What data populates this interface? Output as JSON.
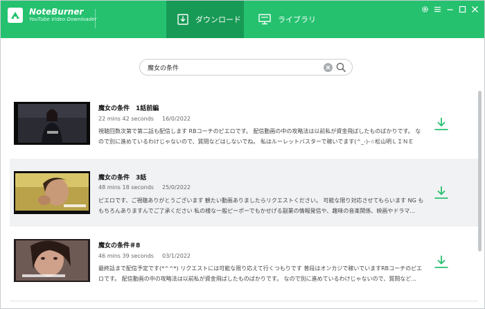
{
  "app": {
    "name": "NoteBurner",
    "subtitle": "YouTube Video Downloader",
    "accent_color": "#25c16f",
    "active_tab_color": "#179a55"
  },
  "tabs": [
    {
      "label": "ダウンロード",
      "icon": "download-icon",
      "active": true
    },
    {
      "label": "ライブラリ",
      "icon": "monitor-icon",
      "active": false
    }
  ],
  "window_controls": [
    "gear-icon",
    "menu-icon",
    "minimize-icon",
    "maximize-icon",
    "close-icon"
  ],
  "search": {
    "value": "魔女の条件",
    "placeholder": ""
  },
  "results": [
    {
      "title": "魔女の条件　1話前編",
      "duration": "22 mins 42 seconds",
      "date": "16/0/2022",
      "description": "視聴回数次第で第二話も配信します RBコーチのピエロです。 配信動画の中の攻略法は以前私が資金飛ばしたものばかりです。 なので別に進めているわけじゃないので、質問などはしないでね。 私はルーレットバスターで稼いでます(^_-)-☆松山明ＬＩＮＥコ..."
    },
    {
      "title": "魔女の条件　3話",
      "duration": "48 mins 18 seconds",
      "date": "25/0/2022",
      "description": "ピエロです、ご視聴ありがとうございます 観たい動画ありましたらリクエストください。 可能な限り対応させてもらいます NG ももちろんありますんでご了承ください 私の様な一般ピーポーでもかせげる副業の情報発信や、趣味の音楽関係、映画やドラマ..."
    },
    {
      "title": "魔女の条件＃8",
      "duration": "46 mins 39 seconds",
      "date": "03/1/2022",
      "description": "最終話まで配信予定です(*^^*) リクエストには可能な限り応えて行くつもりです 普段はオンカジで稼いでいますRBコーチのピエロです。 配信動画の中の攻略法は以前私が資金飛ばしたものばかりです。 なので別に進めているわけじゃないので、質問など..."
    }
  ]
}
